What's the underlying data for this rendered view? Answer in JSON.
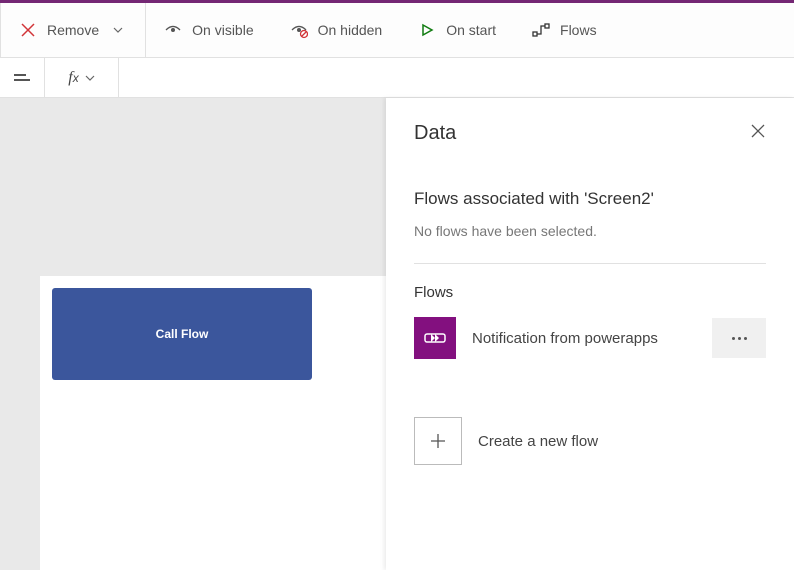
{
  "ribbon": {
    "remove": "Remove",
    "on_visible": "On visible",
    "on_hidden": "On hidden",
    "on_start": "On start",
    "flows": "Flows"
  },
  "formula": {
    "value": ""
  },
  "canvas": {
    "button_label": "Call Flow"
  },
  "panel": {
    "title": "Data",
    "associated_heading": "Flows associated with 'Screen2'",
    "associated_empty": "No flows have been selected.",
    "flows_heading": "Flows",
    "flow_item_name": "Notification from powerapps",
    "create_label": "Create a new flow"
  }
}
